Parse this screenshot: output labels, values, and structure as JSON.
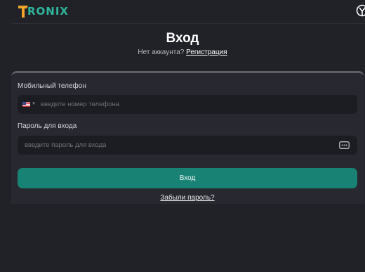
{
  "header": {
    "logo_text": "RONIX",
    "logo_mark": "T",
    "right_icon": "theme-toggle-icon"
  },
  "title": "Вход",
  "subline": {
    "question": "Нет аккаунта?",
    "register_link": "Регистрация"
  },
  "form": {
    "phone_label": "Мобильный телефон",
    "phone_placeholder": "введите номер телефона",
    "country_icon": "us-flag-icon",
    "password_label": "Пароль для входа",
    "password_placeholder": "введите пароль для входа",
    "password_toggle_icon": "show-password-icon",
    "submit_label": "Вход",
    "forgot_link": "Забыли пароль?"
  },
  "colors": {
    "background": "#212228",
    "card": "#282930",
    "field": "#1c1d23",
    "accent": "#188274",
    "logo_teal": "#2fb59b",
    "logo_orange": "#f0a52a"
  }
}
